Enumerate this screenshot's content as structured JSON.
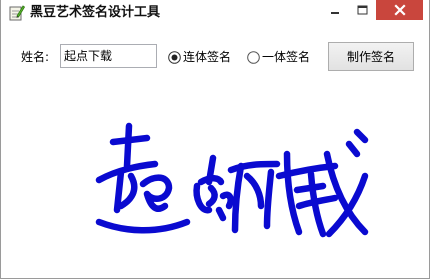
{
  "window": {
    "title": "黑豆艺术签名设计工具"
  },
  "titlebar": {
    "app_icon": "pencil-notepad-icon",
    "minimize_icon": "minimize-icon",
    "maximize_icon": "maximize-icon",
    "close_icon": "close-icon",
    "close_color": "#c9463d"
  },
  "form": {
    "name_label": "姓名:",
    "name_value": "起点下载",
    "options": [
      {
        "label": "连体签名",
        "selected": true
      },
      {
        "label": "一体签名",
        "selected": false
      }
    ],
    "make_button": "制作签名"
  },
  "signature": {
    "text": "起点下载",
    "color": "#0a0ad0"
  }
}
